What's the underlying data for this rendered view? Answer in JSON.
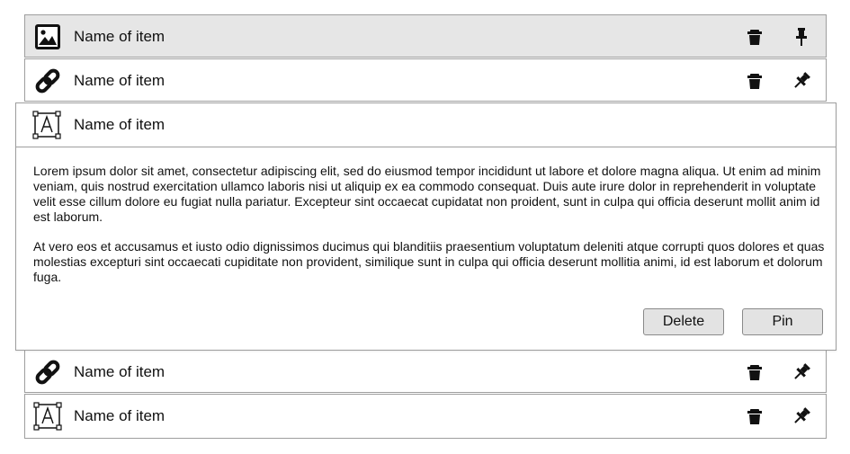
{
  "items": [
    {
      "label": "Name of item",
      "icon": "image-icon",
      "selected": true,
      "pin_icon": "pin-upright-icon"
    },
    {
      "label": "Name of item",
      "icon": "link-icon",
      "selected": false,
      "pin_icon": "pin-tilted-icon"
    },
    {
      "label": "Name of item",
      "icon": "text-frame-icon",
      "expanded": true
    },
    {
      "label": "Name of item",
      "icon": "link-icon",
      "selected": false,
      "pin_icon": "pin-tilted-icon"
    },
    {
      "label": "Name of item",
      "icon": "text-frame-icon",
      "selected": false,
      "pin_icon": "pin-tilted-icon"
    }
  ],
  "expanded_item": {
    "label": "Name of item",
    "paragraphs": [
      "Lorem ipsum dolor sit amet, consectetur adipiscing elit, sed do eiusmod tempor incididunt ut labore et dolore magna aliqua. Ut enim ad minim veniam, quis nostrud exercitation ullamco laboris nisi ut aliquip ex ea commodo consequat. Duis aute irure dolor in reprehenderit in voluptate velit esse cillum dolore eu fugiat nulla pariatur. Excepteur sint occaecat cupidatat non proident, sunt in culpa qui officia deserunt mollit anim id est laborum.",
      "At vero eos et accusamus et iusto odio dignissimos ducimus qui blanditiis praesentium voluptatum deleniti atque corrupti quos dolores et quas molestias excepturi sint occaecati cupiditate non provident, similique sunt in culpa qui officia deserunt mollitia animi, id est laborum et dolorum fuga."
    ],
    "delete_label": "Delete",
    "pin_label": "Pin"
  },
  "colors": {
    "selected_row_bg": "#e6e6e6",
    "border": "#9e9e9e",
    "button_bg": "#e3e3e3"
  }
}
